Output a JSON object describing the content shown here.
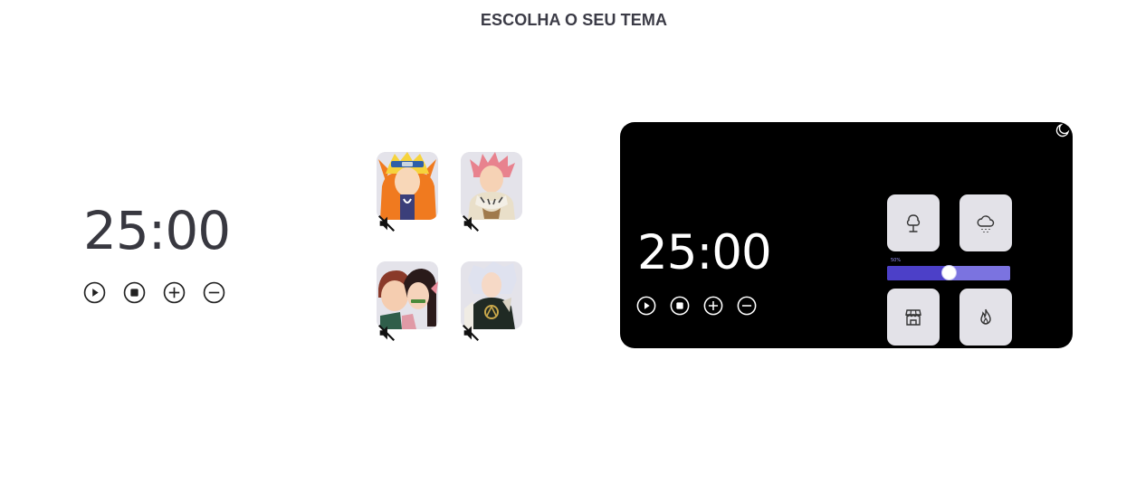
{
  "header": {
    "title": "ESCOLHA O SEU TEMA"
  },
  "timer_light": {
    "time": "25:00",
    "controls": [
      "play-icon",
      "stop-icon",
      "plus-icon",
      "minus-icon"
    ]
  },
  "sounds": [
    {
      "name": "naruto",
      "muted": true
    },
    {
      "name": "natsu",
      "muted": true
    },
    {
      "name": "tanjiro-nezuko",
      "muted": true
    },
    {
      "name": "yami-black-clover",
      "muted": true
    }
  ],
  "timer_dark": {
    "time": "25:00",
    "controls": [
      "play-icon",
      "stop-icon",
      "plus-icon",
      "minus-icon"
    ],
    "ambient": [
      {
        "icon": "tree-icon"
      },
      {
        "icon": "rain-cloud-icon"
      },
      {
        "icon": "store-icon"
      },
      {
        "icon": "fire-icon"
      }
    ],
    "volume": {
      "label": "50%",
      "level": 0.5
    },
    "theme_toggle_icon": "moon-icon"
  },
  "colors": {
    "dark_bg": "#000000",
    "slider_fill": "#4c40c8",
    "slider_track": "#7b73e0",
    "tile_bg": "#e3e2e8"
  }
}
